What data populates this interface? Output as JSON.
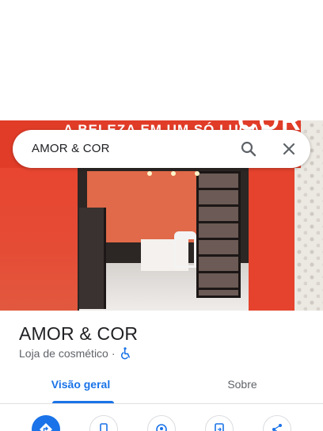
{
  "photo": {
    "banner_text": "A BELEZA EM UM SÓ LUGAR",
    "banner_logo": "COR"
  },
  "search": {
    "query": "AMOR & COR",
    "search_icon": "search-icon",
    "close_icon": "close-icon"
  },
  "place": {
    "name": "AMOR & COR",
    "category": "Loja de cosmético",
    "separator": "·",
    "accessibility_icon": "wheelchair-icon"
  },
  "tabs": [
    {
      "label": "Visão geral",
      "active": true
    },
    {
      "label": "Sobre",
      "active": false
    }
  ],
  "actions": [
    {
      "icon": "directions-icon"
    },
    {
      "icon": "phone-icon"
    },
    {
      "icon": "location-icon"
    },
    {
      "icon": "send-to-phone-icon"
    },
    {
      "icon": "share-icon"
    }
  ],
  "colors": {
    "accent": "#1a73e8",
    "text_primary": "#202124",
    "text_secondary": "#5f6368",
    "store_red": "#e8442c"
  }
}
